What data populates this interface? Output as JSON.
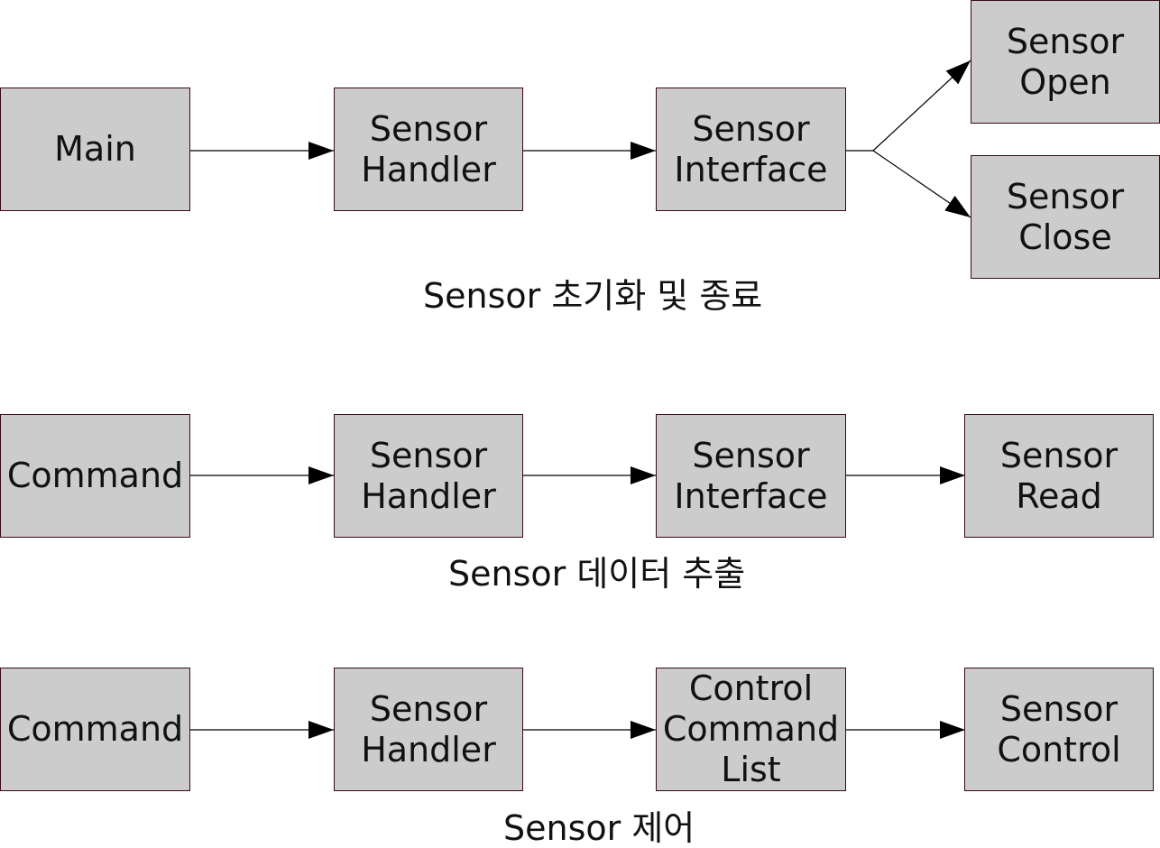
{
  "row1": {
    "main": "Main",
    "handler": "Sensor\nHandler",
    "interface": "Sensor\nInterface",
    "open": "Sensor\nOpen",
    "close": "Sensor\nClose",
    "caption": "Sensor 초기화 및 종료"
  },
  "row2": {
    "command": "Command",
    "handler": "Sensor\nHandler",
    "interface": "Sensor\nInterface",
    "read": "Sensor\nRead",
    "caption": "Sensor 데이터 추출"
  },
  "row3": {
    "command": "Command",
    "handler": "Sensor\nHandler",
    "control_list": "Control\nCommand\nList",
    "control": "Sensor\nControl",
    "caption": "Sensor 제어"
  }
}
